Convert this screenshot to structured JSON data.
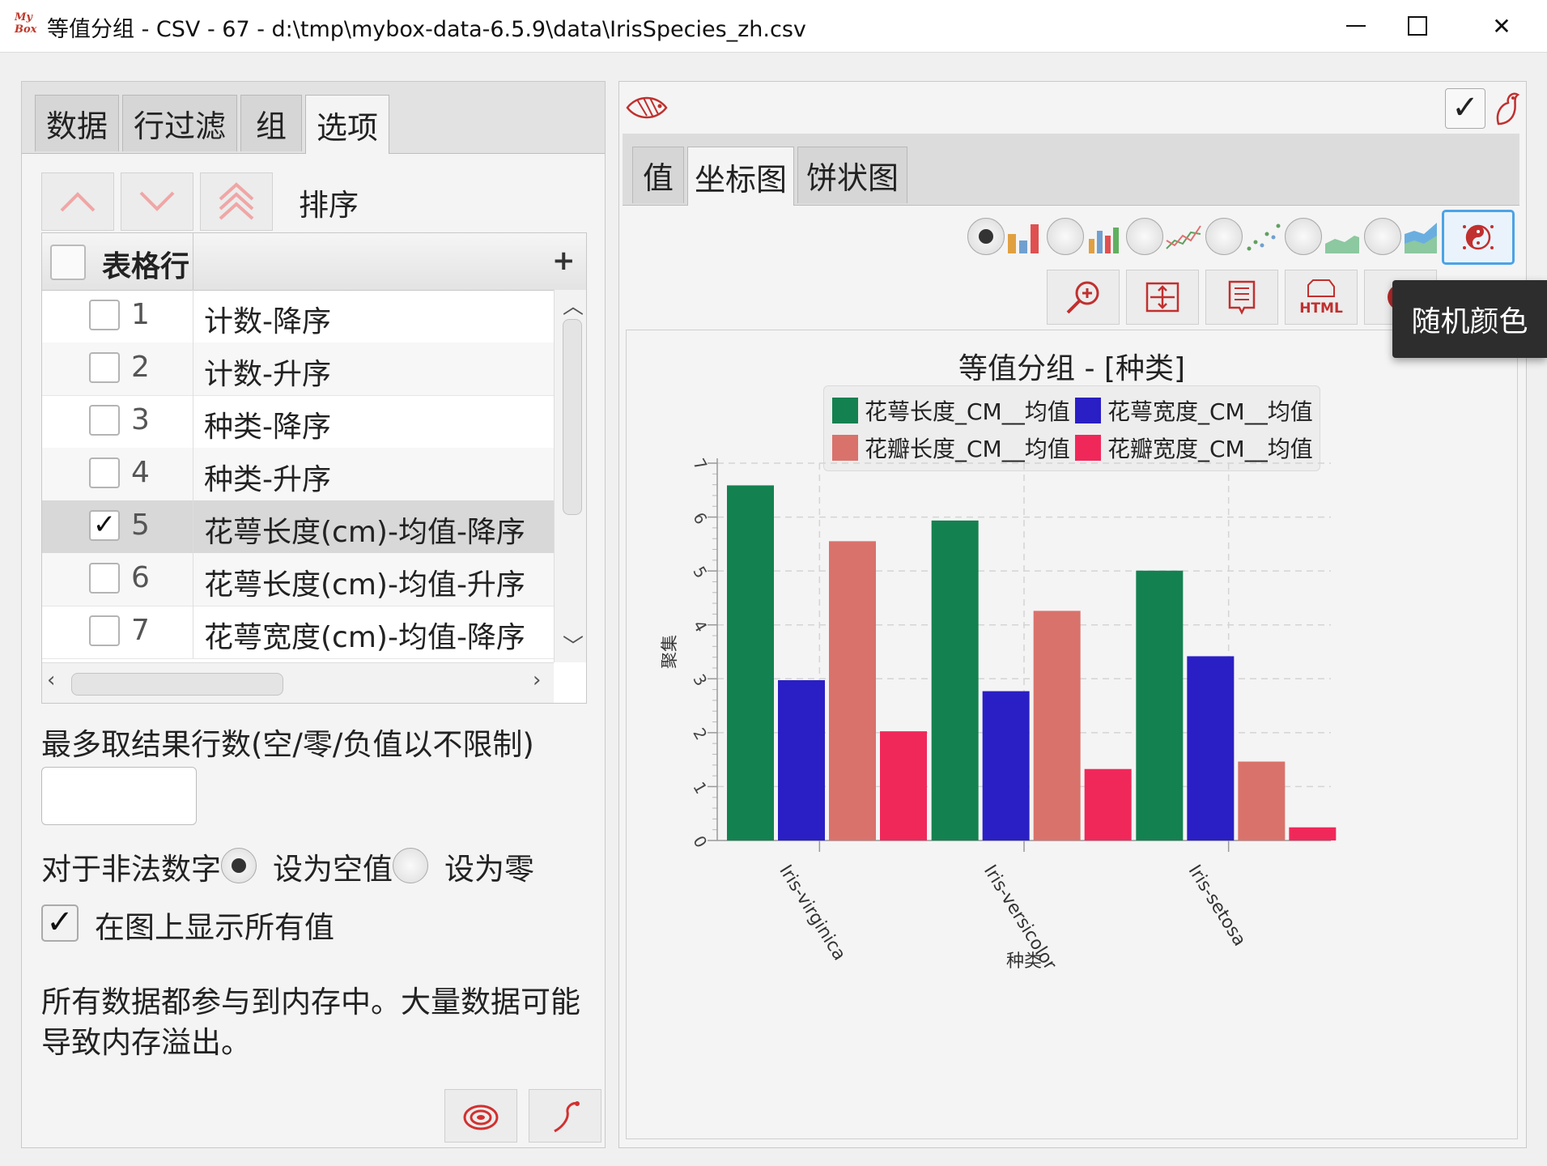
{
  "window": {
    "title": "等值分组 - CSV - 67 - d:\\tmp\\mybox-data-6.5.9\\data\\IrisSpecies_zh.csv",
    "logo_line1": "My",
    "logo_line2": "Box"
  },
  "left": {
    "tabs": [
      {
        "label": "数据"
      },
      {
        "label": "行过滤"
      },
      {
        "label": "组"
      },
      {
        "label": "选项"
      }
    ],
    "active_tab": "选项",
    "sort_label": "排序",
    "table": {
      "header": "表格行",
      "plus": "+",
      "rows": [
        {
          "num": "1",
          "text": "计数-降序",
          "checked": false
        },
        {
          "num": "2",
          "text": "计数-升序",
          "checked": false
        },
        {
          "num": "3",
          "text": "种类-降序",
          "checked": false
        },
        {
          "num": "4",
          "text": "种类-升序",
          "checked": false
        },
        {
          "num": "5",
          "text": "花萼长度(cm)-均值-降序",
          "checked": true
        },
        {
          "num": "6",
          "text": "花萼长度(cm)-均值-升序",
          "checked": false
        },
        {
          "num": "7",
          "text": "花萼宽度(cm)-均值-降序",
          "checked": false
        }
      ],
      "check_mark": "✓"
    },
    "max_rows_label": "最多取结果行数(空/零/负值以不限制)",
    "max_rows_value": "",
    "invalid_label": "对于非法数字",
    "radio_null": "设为空值",
    "radio_zero": "设为零",
    "show_values_label": "在图上显示所有值",
    "show_values_checked": true,
    "note": "所有数据都参与到内存中。大量数据可能导致内存溢出。"
  },
  "right": {
    "tabs": [
      {
        "label": "值"
      },
      {
        "label": "坐标图"
      },
      {
        "label": "饼状图"
      }
    ],
    "active_tab": "坐标图",
    "confirm_mark": "✓",
    "tooltip": "随机颜色",
    "html_label": "HTML"
  },
  "chart_data": {
    "type": "bar",
    "title": "等值分组 - [种类]",
    "xlabel": "种类",
    "ylabel": "聚集",
    "categories": [
      "Iris-virginica",
      "Iris-versicolor",
      "Iris-setosa"
    ],
    "ylim": [
      0,
      7
    ],
    "yticks": [
      "0",
      "1",
      "2",
      "3",
      "4",
      "5",
      "6",
      "7"
    ],
    "grid": true,
    "legend_position": "top",
    "series": [
      {
        "name": "花萼长度_CM__均值",
        "color": "#148150",
        "values": [
          6.588,
          5.936,
          5.006
        ]
      },
      {
        "name": "花萼宽度_CM__均值",
        "color": "#2a1fc4",
        "values": [
          2.974,
          2.77,
          3.418
        ]
      },
      {
        "name": "花瓣长度_CM__均值",
        "color": "#d9726b",
        "values": [
          5.552,
          4.26,
          1.464
        ]
      },
      {
        "name": "花瓣宽度_CM__均值",
        "color": "#f0285a",
        "values": [
          2.026,
          1.326,
          0.244
        ]
      }
    ]
  }
}
